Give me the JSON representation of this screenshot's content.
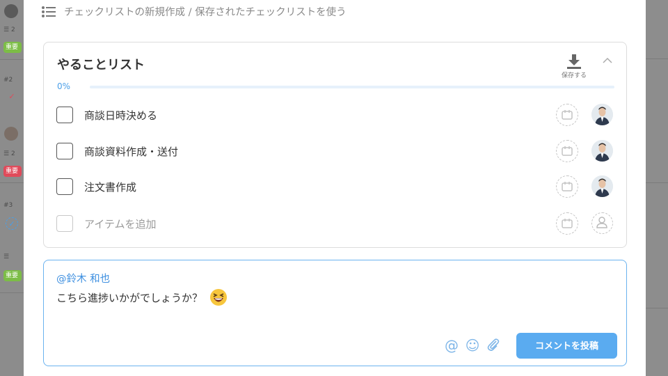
{
  "background": {
    "cards": [
      {
        "num": "",
        "count": "2",
        "tag": "重要",
        "tag_color": "#7cbd46"
      },
      {
        "num": "#2",
        "count": "2",
        "tag": "重要",
        "tag_color": "#e04a5a",
        "check": "✓",
        "check_color": "#e04a5a"
      },
      {
        "num": "#3",
        "count": "",
        "tag": "重要",
        "tag_color": "#7cbd46",
        "check": "✓",
        "check_color": "#4a9fe8"
      }
    ]
  },
  "header": {
    "icon": "list-icon",
    "text": "チェックリストの新規作成 / 保存されたチェックリストを使う"
  },
  "checklist": {
    "title": "やることリスト",
    "save_label": "保存する",
    "save_icon": "download-icon",
    "collapse_icon": "chevron-up-icon",
    "progress_text": "0%",
    "progress_value": 0,
    "items": [
      {
        "label": "商談日時決める"
      },
      {
        "label": "商談資料作成・送付"
      },
      {
        "label": "注文書作成"
      }
    ],
    "add_placeholder": "アイテムを追加"
  },
  "comment": {
    "mention": "@鈴木 和也",
    "text": "こちら進捗いかがでしょうか？",
    "emoji": "laughing-emoji",
    "tools": {
      "mention": "@",
      "emoji": "☺",
      "attach": "paperclip-icon"
    },
    "post_label": "コメントを投稿"
  },
  "colors": {
    "accent": "#4a9fe8",
    "post_button": "#5aabf0"
  }
}
